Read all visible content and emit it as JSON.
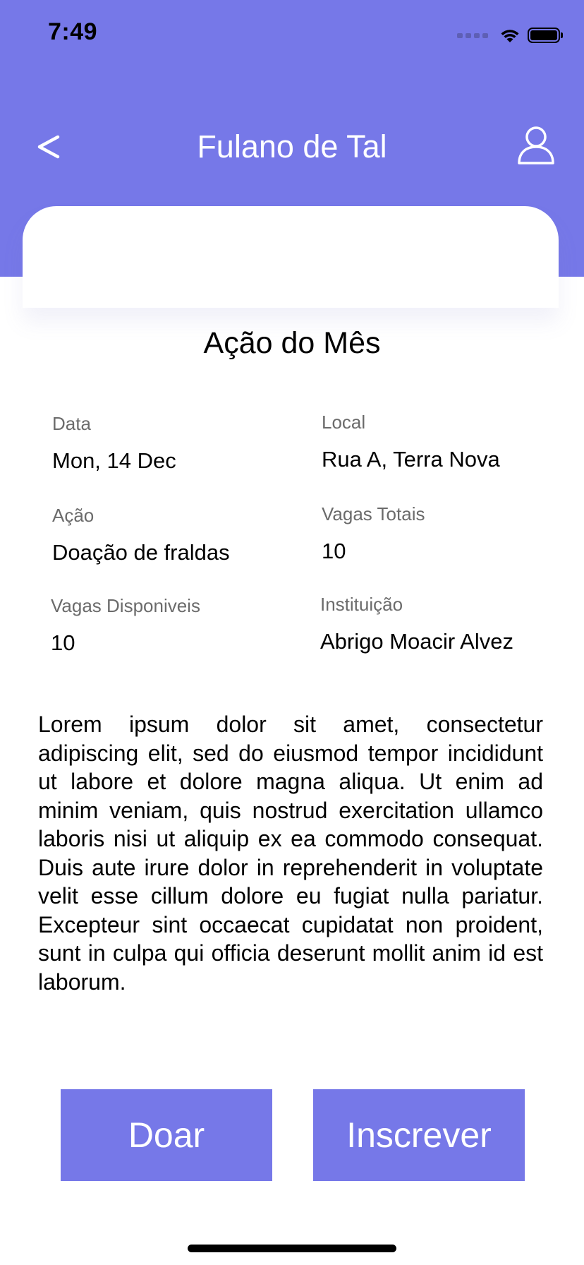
{
  "status_bar": {
    "time": "7:49"
  },
  "header": {
    "title": "Fulano de Tal",
    "back_label": "<",
    "background_color": "#7678E8",
    "back_icon": "chevron-left-icon",
    "profile_icon": "user-icon"
  },
  "section": {
    "title": "Ação do Mês"
  },
  "details": {
    "data": {
      "label": "Data",
      "value": "Mon, 14 Dec"
    },
    "local": {
      "label": "Local",
      "value": "Rua A, Terra Nova"
    },
    "acao": {
      "label": "Ação",
      "value": "Doação de fraldas"
    },
    "vagas_totais": {
      "label": "Vagas Totais",
      "value": "10"
    },
    "vagas_disponiveis": {
      "label": "Vagas Disponiveis",
      "value": "10"
    },
    "instituicao": {
      "label": "Instituição",
      "value": "Abrigo Moacir Alvez"
    }
  },
  "description": "Lorem ipsum dolor sit amet, consectetur adipiscing elit, sed do eiusmod tempor incididunt ut labore et dolore magna aliqua. Ut enim ad minim veniam, quis nostrud exercitation ullamco laboris nisi ut aliquip ex ea commodo consequat. Duis aute irure dolor in reprehenderit in voluptate velit esse cillum dolore eu fugiat nulla pariatur. Excepteur sint occaecat cupidatat non proident, sunt in culpa qui officia deserunt mollit anim id est laborum.",
  "actions": {
    "donate_label": "Doar",
    "subscribe_label": "Inscrever",
    "button_color": "#7678E8"
  }
}
